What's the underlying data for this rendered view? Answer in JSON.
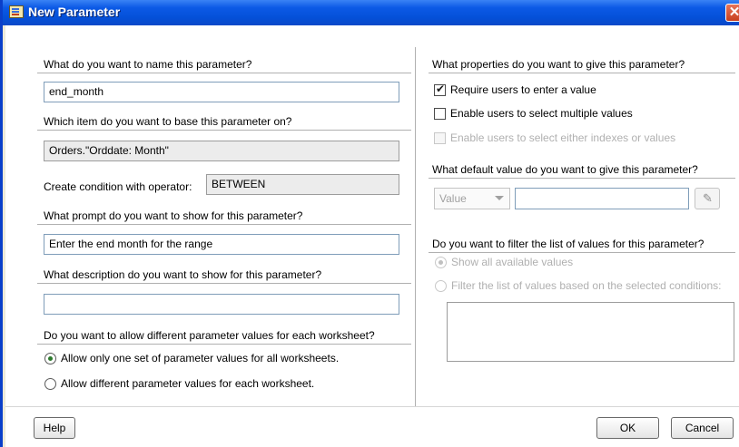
{
  "window": {
    "title": "New Parameter",
    "close_icon": "✕"
  },
  "left": {
    "name_question": "What do you want to name this parameter?",
    "name_value": "end_month",
    "base_question": "Which item do you want to base this parameter on?",
    "base_value": "Orders.\"Orddate: Month\"",
    "operator_label": "Create condition with operator:",
    "operator_value": "BETWEEN",
    "prompt_question": "What prompt do you want to show for this parameter?",
    "prompt_value": "Enter the end month for the range",
    "description_question": "What description do you want to show for this parameter?",
    "description_value": "",
    "worksheet_question": "Do you want to allow different parameter values for each worksheet?",
    "radio_one_label": "Allow only one set of parameter values for all worksheets.",
    "radio_one_selected": true,
    "radio_diff_label": "Allow different parameter values for each worksheet.",
    "radio_diff_selected": false
  },
  "right": {
    "properties_question": "What properties do you want to give this parameter?",
    "require_label": "Require users to enter a value",
    "require_checked": true,
    "multiple_label": "Enable users to select multiple values",
    "multiple_checked": false,
    "indexes_label": "Enable users to select either indexes or values",
    "indexes_checked": false,
    "default_question": "What default value do you want to give this parameter?",
    "default_type": "Value",
    "default_value": "",
    "filter_question": "Do you want to filter the list of values for this parameter?",
    "show_all_label": "Show all available values",
    "filter_conditions_label": "Filter the list of values based on the selected conditions:"
  },
  "footer": {
    "help_label": "Help",
    "ok_label": "OK",
    "cancel_label": "Cancel"
  },
  "colors": {
    "titlebar": "#0450d8",
    "close": "#c8401e",
    "radio_dot": "#2d7a2d"
  },
  "icons": {
    "title": "parameter-dialog-icon",
    "close": "close-icon",
    "picker": "value-picker-icon"
  }
}
